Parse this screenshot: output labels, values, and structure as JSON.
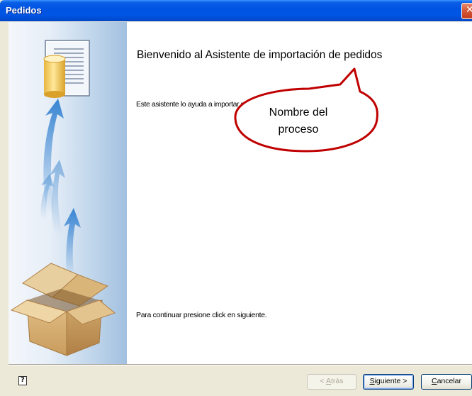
{
  "window": {
    "title": "Pedidos",
    "close_symbol": "✕"
  },
  "wizard": {
    "heading": "Bienvenido al Asistente de importación de pedidos",
    "description": "Este asistente lo ayuda a importar pedid",
    "continue_text": "Para continuar presione click en siguiente."
  },
  "callout": {
    "line1": "Nombre del",
    "line2": "proceso"
  },
  "buttons": {
    "back_accel": "A",
    "back_rest": "trás",
    "back_prefix": "< ",
    "next_accel": "S",
    "next_rest": "iguiente",
    "next_suffix": " >",
    "cancel_accel": "C",
    "cancel_rest": "ancelar"
  },
  "icons": {
    "help": "help-icon",
    "document": "document-database-icon",
    "box": "open-box-icon",
    "arrows": "upload-arrows-icon"
  },
  "colors": {
    "titlebar": "#0054e3",
    "callout_border": "#c00000",
    "arrow_blue": "#2f7fd0"
  }
}
